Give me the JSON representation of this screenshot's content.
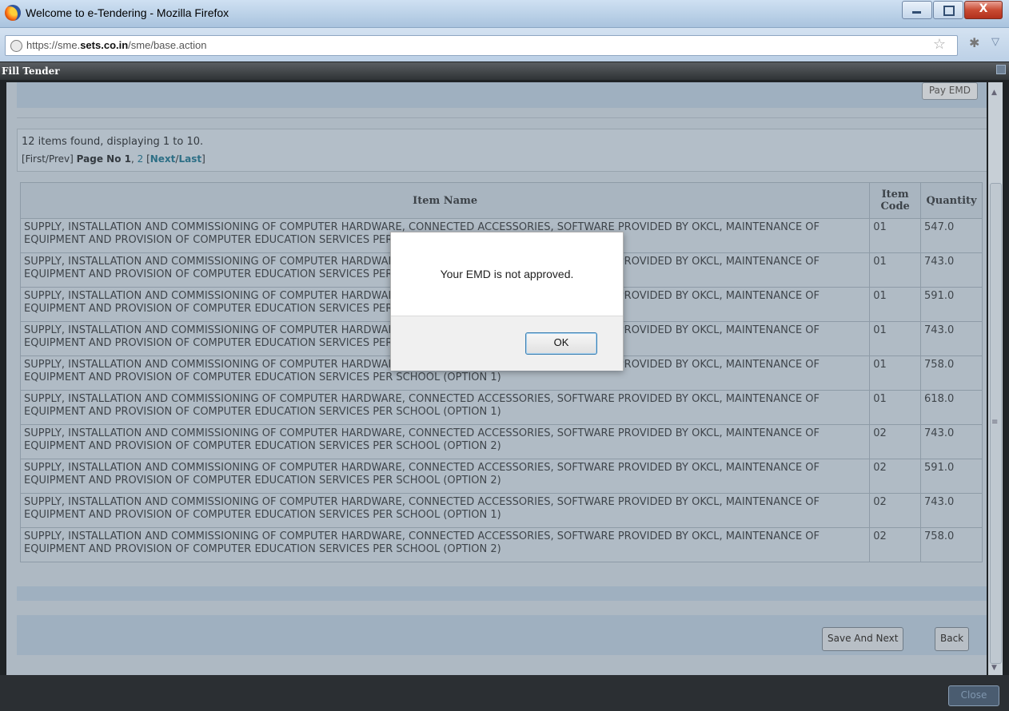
{
  "window": {
    "title": "Welcome to e-Tendering - Mozilla Firefox"
  },
  "browser": {
    "url_prefix": "https://sme.",
    "url_domain": "sets.co.in",
    "url_path": "/sme/base.action"
  },
  "panel": {
    "title": "Fill Tender"
  },
  "actions": {
    "pay_emd": "Pay EMD",
    "save_next": "Save And Next",
    "back": "Back",
    "close": "Close"
  },
  "pagination": {
    "summary": "12 items found, displaying 1 to 10.",
    "first_prev": "[First/Prev]",
    "page_label": "Page No 1",
    "page2": "2",
    "next": "Next",
    "last": "Last"
  },
  "table": {
    "headers": [
      "Item Name",
      "Item Code",
      "Quantity"
    ],
    "rows": [
      {
        "name": "SUPPLY, INSTALLATION AND COMMISSIONING OF COMPUTER HARDWARE, CONNECTED ACCESSORIES, SOFTWARE PROVIDED BY OKCL, MAINTENANCE OF EQUIPMENT AND PROVISION OF COMPUTER EDUCATION SERVICES PER SCHOOL (OPTION 1)",
        "code": "01",
        "qty": "547.0"
      },
      {
        "name": "SUPPLY, INSTALLATION AND COMMISSIONING OF COMPUTER HARDWARE, CONNECTED ACCESSORIES, SOFTWARE PROVIDED BY OKCL, MAINTENANCE OF EQUIPMENT AND PROVISION OF COMPUTER EDUCATION SERVICES PER SCHOOL (OPTION 1)",
        "code": "01",
        "qty": "743.0"
      },
      {
        "name": "SUPPLY, INSTALLATION AND COMMISSIONING OF COMPUTER HARDWARE, CONNECTED ACCESSORIES, SOFTWARE PROVIDED BY OKCL, MAINTENANCE OF EQUIPMENT AND PROVISION OF COMPUTER EDUCATION SERVICES PER SCHOOL (OPTION 1)",
        "code": "01",
        "qty": "591.0"
      },
      {
        "name": "SUPPLY, INSTALLATION AND COMMISSIONING OF COMPUTER HARDWARE, CONNECTED ACCESSORIES, SOFTWARE PROVIDED BY OKCL, MAINTENANCE OF EQUIPMENT AND PROVISION OF COMPUTER EDUCATION SERVICES PER SCHOOL (OPTION 2)",
        "code": "01",
        "qty": "743.0"
      },
      {
        "name": "SUPPLY, INSTALLATION AND COMMISSIONING OF COMPUTER HARDWARE, CONNECTED ACCESSORIES, SOFTWARE PROVIDED BY OKCL, MAINTENANCE OF EQUIPMENT AND PROVISION OF COMPUTER EDUCATION SERVICES PER SCHOOL (OPTION 1)",
        "code": "01",
        "qty": "758.0"
      },
      {
        "name": "SUPPLY, INSTALLATION AND COMMISSIONING OF COMPUTER HARDWARE, CONNECTED ACCESSORIES, SOFTWARE PROVIDED BY OKCL, MAINTENANCE OF EQUIPMENT AND PROVISION OF COMPUTER EDUCATION SERVICES PER SCHOOL (OPTION 1)",
        "code": "01",
        "qty": "618.0"
      },
      {
        "name": "SUPPLY, INSTALLATION AND COMMISSIONING OF COMPUTER HARDWARE, CONNECTED ACCESSORIES, SOFTWARE PROVIDED BY OKCL, MAINTENANCE OF EQUIPMENT AND PROVISION OF COMPUTER EDUCATION SERVICES PER SCHOOL (OPTION 2)",
        "code": "02",
        "qty": "743.0"
      },
      {
        "name": "SUPPLY, INSTALLATION AND COMMISSIONING OF COMPUTER HARDWARE, CONNECTED ACCESSORIES, SOFTWARE PROVIDED BY OKCL, MAINTENANCE OF EQUIPMENT AND PROVISION OF COMPUTER EDUCATION SERVICES PER SCHOOL (OPTION 2)",
        "code": "02",
        "qty": "591.0"
      },
      {
        "name": "SUPPLY, INSTALLATION AND COMMISSIONING OF COMPUTER HARDWARE, CONNECTED ACCESSORIES, SOFTWARE PROVIDED BY OKCL, MAINTENANCE OF EQUIPMENT AND PROVISION OF COMPUTER EDUCATION SERVICES PER SCHOOL (OPTION 1)",
        "code": "02",
        "qty": "743.0"
      },
      {
        "name": "SUPPLY, INSTALLATION AND COMMISSIONING OF COMPUTER HARDWARE, CONNECTED ACCESSORIES, SOFTWARE PROVIDED BY OKCL, MAINTENANCE OF EQUIPMENT AND PROVISION OF COMPUTER EDUCATION SERVICES PER SCHOOL (OPTION 2)",
        "code": "02",
        "qty": "758.0"
      }
    ]
  },
  "dialog": {
    "message": "Your EMD is not approved.",
    "ok": "OK"
  },
  "icons": {
    "browser": "firefox-icon",
    "site": "globe-icon",
    "bookmark": "star-icon"
  }
}
